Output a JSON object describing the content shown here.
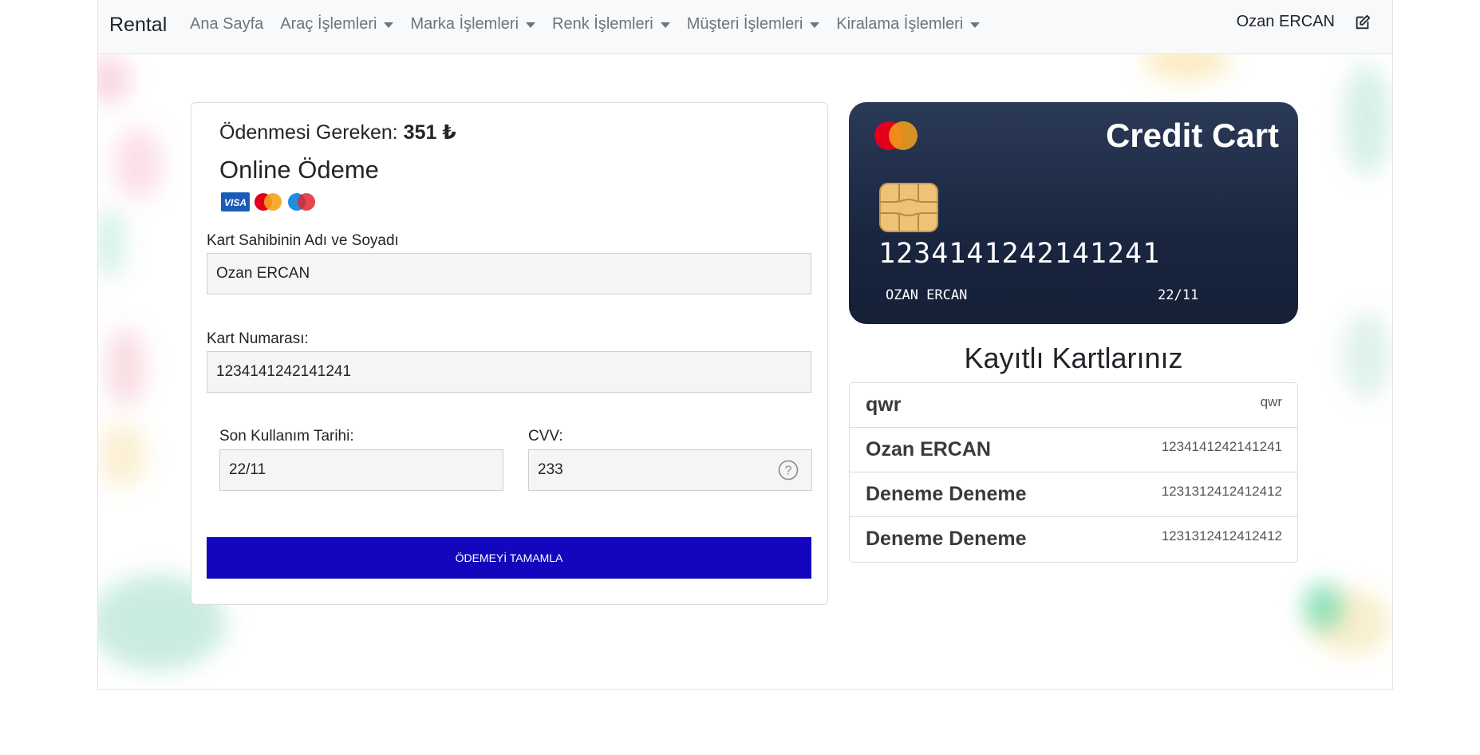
{
  "navbar": {
    "brand": "Rental",
    "items": [
      {
        "label": "Ana Sayfa",
        "dropdown": false
      },
      {
        "label": "Araç İşlemleri",
        "dropdown": true
      },
      {
        "label": "Marka İşlemleri",
        "dropdown": true
      },
      {
        "label": "Renk İşlemleri",
        "dropdown": true
      },
      {
        "label": "Müşteri İşlemleri",
        "dropdown": true
      },
      {
        "label": "Kiralama İşlemleri",
        "dropdown": true
      }
    ],
    "user": "Ozan ERCAN",
    "edit_icon": "edit-icon"
  },
  "payment": {
    "due_label": "Ödenmesi Gereken:",
    "due_amount": "351 ₺",
    "title": "Online Ödeme",
    "brand_icons": [
      "visa-icon",
      "mastercard-icon",
      "maestro-icon"
    ],
    "holder_label": "Kart Sahibinin Adı ve Soyadı",
    "holder_value": "Ozan ERCAN",
    "number_label": "Kart Numarası:",
    "number_value": "1234141242141241",
    "expiry_label": "Son Kullanım Tarihi:",
    "expiry_value": "22/11",
    "cvv_label": "CVV:",
    "cvv_value": "233",
    "submit_label": "ÖDEMEYİ TAMAMLA"
  },
  "credit_card": {
    "title": "Credit Cart",
    "number": "1234141242141241",
    "name": "OZAN ERCAN",
    "expiry": "22/11"
  },
  "saved_cards": {
    "title": "Kayıtlı Kartlarınız",
    "items": [
      {
        "name": "qwr",
        "number": "qwr"
      },
      {
        "name": "Ozan ERCAN",
        "number": "1234141242141241"
      },
      {
        "name": "Deneme Deneme",
        "number": "1231312412412412"
      },
      {
        "name": "Deneme Deneme",
        "number": "1231312412412412"
      }
    ]
  },
  "colors": {
    "navbar_bg": "#f8f9fa",
    "button_bg": "#1207bd",
    "card_bg": "#1a2640"
  }
}
